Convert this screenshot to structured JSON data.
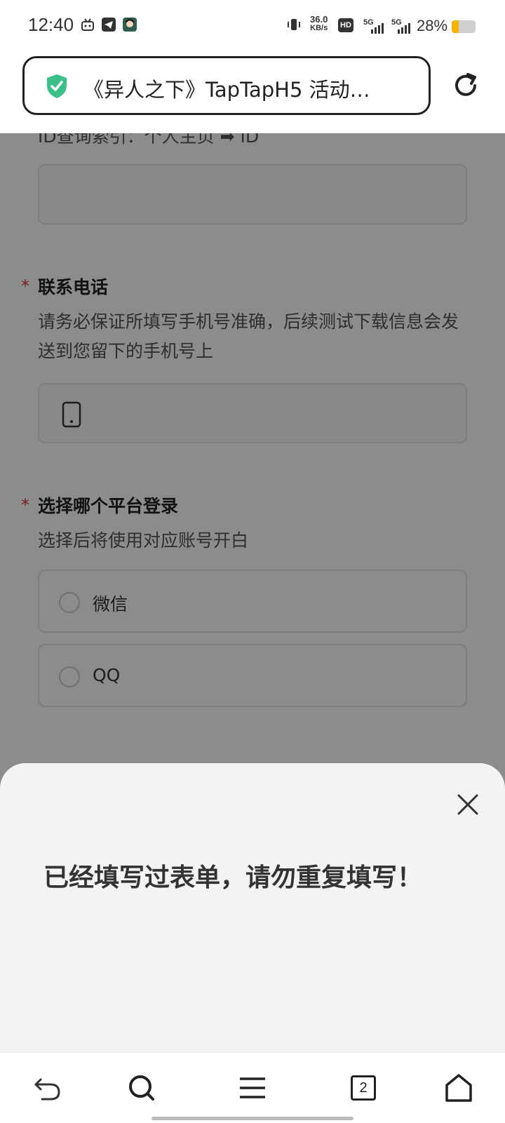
{
  "status_bar": {
    "time": "12:40",
    "net_speed_value": "36.0",
    "net_speed_unit": "KB/s",
    "hd_label": "HD",
    "sim1": "5G",
    "sim2": "5G",
    "battery_percent": "28%",
    "battery_level": 0.28,
    "icons": [
      "bilibili-icon",
      "telegram-icon",
      "app-avatar-icon",
      "vibrate-icon",
      "hd-voice-icon",
      "signal-icon",
      "signal-icon"
    ]
  },
  "browser": {
    "url_title": "《异人之下》TapTapH5 活动…",
    "secure_icon": "shield-check-icon",
    "reload_icon": "reload-icon"
  },
  "form": {
    "id_hint": "ID查询索引：个人主页 ➡ ID",
    "phone": {
      "required_mark": "*",
      "label": "联系电话",
      "description": "请务必保证所填写手机号准确，后续测试下载信息会发送到您留下的手机号上",
      "icon": "phone-icon"
    },
    "platform": {
      "required_mark": "*",
      "label": "选择哪个平台登录",
      "description": "选择后将使用对应账号开白",
      "options": [
        "微信",
        "QQ"
      ]
    }
  },
  "sheet": {
    "message": "已经填写过表单，请勿重复填写！",
    "close_icon": "close-icon"
  },
  "bottom_nav": {
    "items": [
      "back-icon",
      "search-icon",
      "menu-icon",
      "tabs-icon",
      "home-icon"
    ],
    "tab_count": "2"
  },
  "colors": {
    "accent_green": "#3cc08a",
    "required_red": "#e53935",
    "battery_yellow": "#f4b400"
  }
}
